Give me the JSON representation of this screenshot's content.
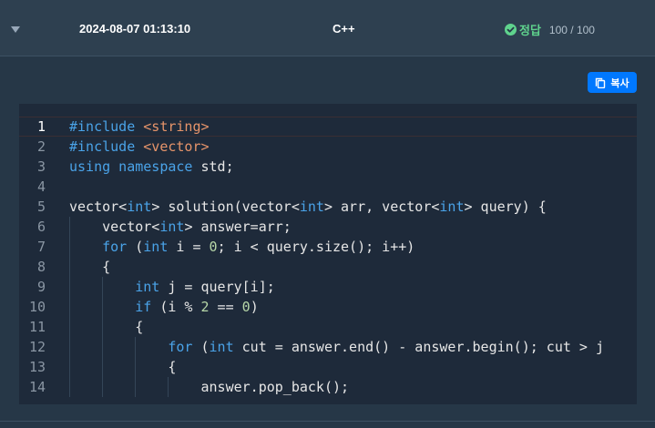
{
  "header": {
    "date": "2024-08-07 01:13:10",
    "language": "C++",
    "status": "정답",
    "score": "100 / 100"
  },
  "toolbar": {
    "copy_label": "복사"
  },
  "colors": {
    "success": "#5fd38d",
    "primary_button": "#0078ff",
    "background": "#263747",
    "editor_background": "#1e2a3a"
  },
  "icons": {
    "toggle": "caret-down-icon",
    "status": "check-circle-icon",
    "copy": "copy-icon"
  },
  "code": {
    "active_line": 1,
    "lines": [
      {
        "n": "1",
        "tokens": [
          [
            "kw",
            "#include "
          ],
          [
            "str",
            "<string>"
          ]
        ]
      },
      {
        "n": "2",
        "tokens": [
          [
            "kw",
            "#include "
          ],
          [
            "str",
            "<vector>"
          ]
        ]
      },
      {
        "n": "3",
        "tokens": [
          [
            "kw",
            "using namespace "
          ],
          [
            "",
            "std;"
          ]
        ]
      },
      {
        "n": "4",
        "tokens": []
      },
      {
        "n": "5",
        "tokens": [
          [
            "",
            "vector<"
          ],
          [
            "kw",
            "int"
          ],
          [
            "",
            "> solution(vector<"
          ],
          [
            "kw",
            "int"
          ],
          [
            "",
            "> arr, vector<"
          ],
          [
            "kw",
            "int"
          ],
          [
            "",
            "> query) {"
          ]
        ]
      },
      {
        "n": "6",
        "tokens": [
          [
            "",
            "    vector<"
          ],
          [
            "kw",
            "int"
          ],
          [
            "",
            "> answer=arr;"
          ]
        ]
      },
      {
        "n": "7",
        "tokens": [
          [
            "",
            "    "
          ],
          [
            "kw",
            "for"
          ],
          [
            "",
            " ("
          ],
          [
            "kw",
            "int"
          ],
          [
            "",
            " i = "
          ],
          [
            "num",
            "0"
          ],
          [
            "",
            "; i < query.size(); i++)"
          ]
        ]
      },
      {
        "n": "8",
        "tokens": [
          [
            "",
            "    {"
          ]
        ]
      },
      {
        "n": "9",
        "tokens": [
          [
            "",
            "        "
          ],
          [
            "kw",
            "int"
          ],
          [
            "",
            " j = query[i];"
          ]
        ]
      },
      {
        "n": "10",
        "tokens": [
          [
            "",
            "        "
          ],
          [
            "kw",
            "if"
          ],
          [
            "",
            " (i % "
          ],
          [
            "num",
            "2"
          ],
          [
            "",
            " == "
          ],
          [
            "num",
            "0"
          ],
          [
            "",
            ")"
          ]
        ]
      },
      {
        "n": "11",
        "tokens": [
          [
            "",
            "        {"
          ]
        ]
      },
      {
        "n": "12",
        "tokens": [
          [
            "",
            "            "
          ],
          [
            "kw",
            "for"
          ],
          [
            "",
            " ("
          ],
          [
            "kw",
            "int"
          ],
          [
            "",
            " cut = answer.end() - answer.begin(); cut > j"
          ]
        ]
      },
      {
        "n": "13",
        "tokens": [
          [
            "",
            "            {"
          ]
        ]
      },
      {
        "n": "14",
        "tokens": [
          [
            "",
            "                answer.pop_back();"
          ]
        ]
      }
    ]
  }
}
